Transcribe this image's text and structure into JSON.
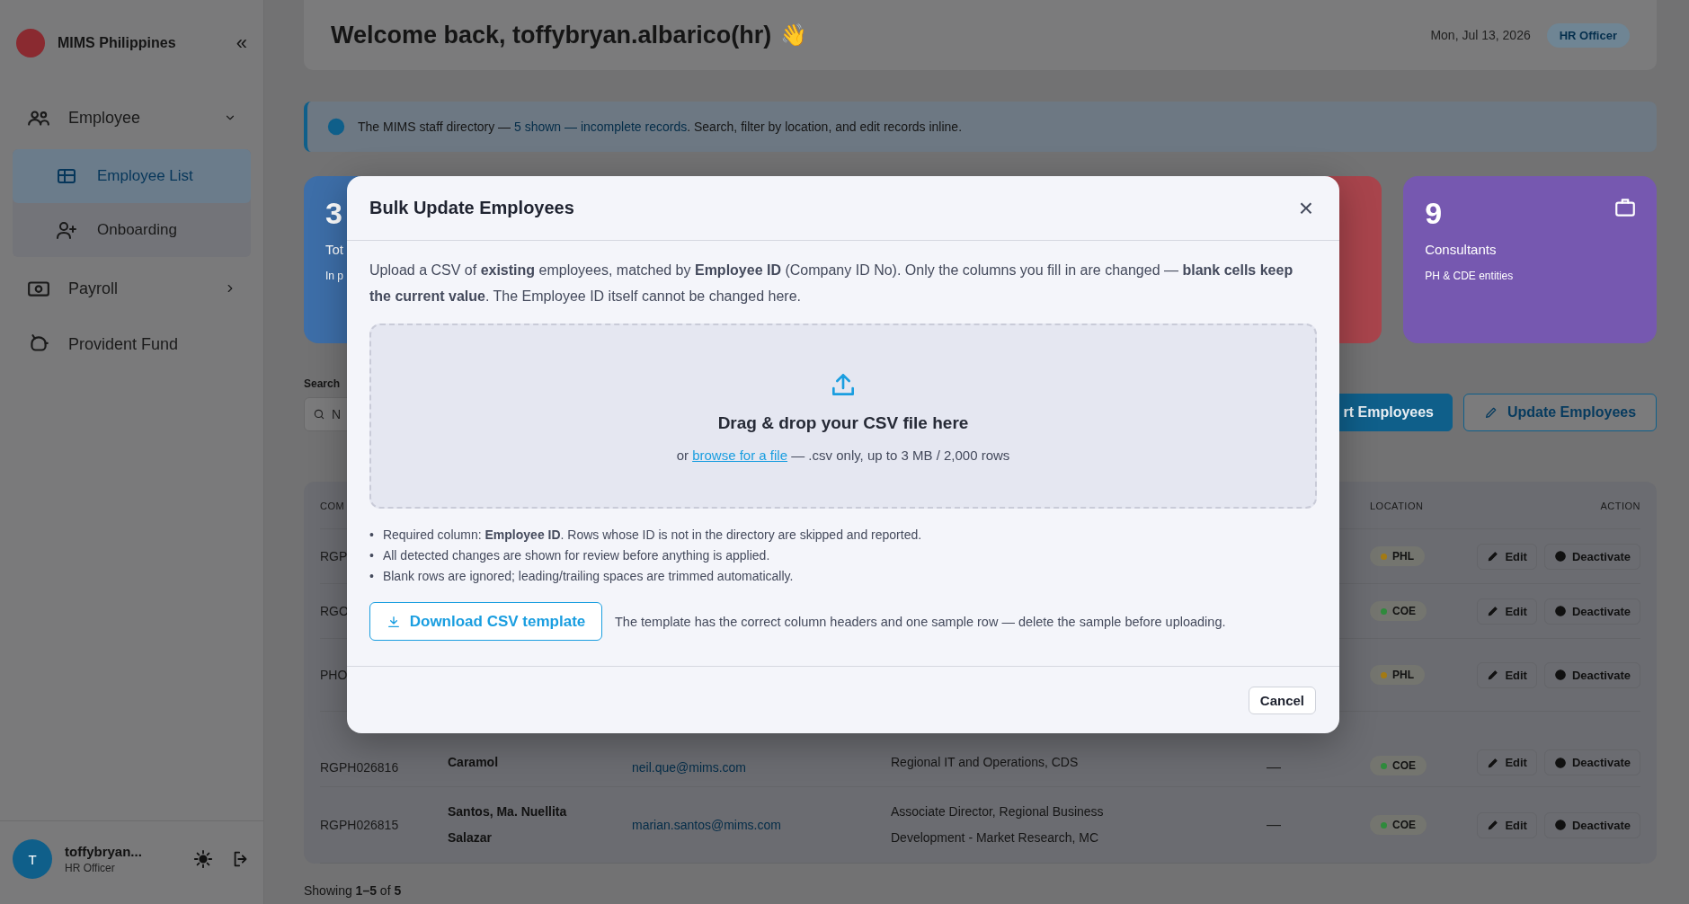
{
  "sidebar": {
    "brand": "MIMS Philippines",
    "collapse_icon": "«",
    "items": [
      {
        "label": "Employee",
        "expanded": true,
        "children": [
          {
            "label": "Employee List",
            "selected": true
          },
          {
            "label": "Onboarding",
            "selected": false
          }
        ]
      },
      {
        "label": "Payroll",
        "expanded": false
      },
      {
        "label": "Provident Fund"
      }
    ],
    "user": {
      "avatar": "T",
      "name": "toffybryan...",
      "role": "HR Officer"
    }
  },
  "header": {
    "greeting": "Welcome back, toffybryan.albarico(hr)",
    "wave": "👋",
    "date": "Mon, Jul 13, 2026",
    "role_badge": "HR Officer"
  },
  "banner": {
    "prefix": "The MIMS staff directory — ",
    "highlight": "5 shown — incomplete records",
    "suffix": ". Search, filter by location, and edit records inline."
  },
  "stat_cards": [
    {
      "value": "3",
      "label": "Tot",
      "note": "In p",
      "color": "#3d6ea8"
    },
    {
      "color": "#a8444c"
    },
    {
      "value": "9",
      "label": "Consultants",
      "note": "PH & CDE entities",
      "color": "#7658b0"
    }
  ],
  "search": {
    "label": "Search",
    "placeholder": "N"
  },
  "actions": [
    {
      "label": "rt Employees",
      "kind": "primary"
    },
    {
      "label": "Update Employees",
      "kind": "outline"
    }
  ],
  "table": {
    "columns": [
      "COM",
      "LOCATION",
      "ACTION"
    ],
    "rows": [
      {
        "company_id": "RGP",
        "location": "PHL",
        "color": "#a37a14",
        "actions": [
          "Edit",
          "Deactivate"
        ]
      },
      {
        "company_id": "RGO",
        "location": "COE",
        "color": "#2f8a3c",
        "actions": [
          "Edit",
          "Deactivate"
        ]
      },
      {
        "company_id": "PHO",
        "location": "PHL",
        "color": "#a37a14",
        "actions": [
          "Edit",
          "Deactivate"
        ]
      },
      {
        "company_id": "RGPH026816",
        "name": [
          "Caramol"
        ],
        "email": "neil.que@mims.com",
        "position": [
          "Regional IT and Operations, CDS"
        ],
        "column_5": "—",
        "location": "COE",
        "color": "#2f8a3c",
        "actions": [
          "Edit",
          "Deactivate"
        ]
      },
      {
        "company_id": "RGPH026815",
        "name": [
          "Santos, Ma. Nuellita",
          "Salazar"
        ],
        "email": "marian.santos@mims.com",
        "position": [
          "Associate Director, Regional Business",
          "Development - Market Research, MC"
        ],
        "column_5": "—",
        "location": "COE",
        "color": "#2f8a3c",
        "actions": [
          "Edit",
          "Deactivate"
        ]
      }
    ]
  },
  "footer": "Showing **1–5** of **5**",
  "modal": {
    "title": "Bulk Update Employees",
    "close": "×",
    "intro": "Upload a CSV of **existing** employees, matched by **Employee ID** (Company ID No). Only the columns you fill in are changed — **blank cells keep the current value**. The Employee ID itself cannot be changed here.",
    "dropzone": {
      "title": "Drag & drop your CSV file here",
      "prefix": "or ",
      "link": "browse for a file",
      "suffix": " — .csv only, up to 3 MB / 2,000 rows"
    },
    "bullet": "•",
    "notes": [
      "Required column: **Employee ID**. Rows whose ID is not in the directory are skipped and reported.",
      "All detected changes are shown for review before anything is applied.",
      "Blank rows are ignored; leading/trailing spaces are trimmed automatically."
    ],
    "download_button": "Download CSV template",
    "download_note": "The template has the correct column headers and one sample row — delete the sample before uploading.",
    "cancel_button": "Cancel"
  }
}
